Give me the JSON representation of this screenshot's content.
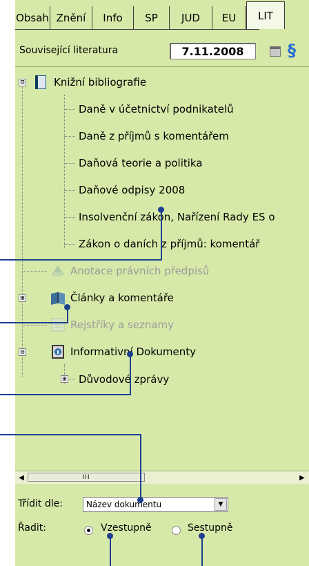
{
  "tabs": [
    "Obsah",
    "Znění",
    "Info",
    "SP",
    "JUD",
    "EU",
    "LIT"
  ],
  "active_tab": "LIT",
  "header": {
    "label": "Související literatura",
    "date": "7.11.2008",
    "paragraph_icon": "§",
    "calendar_icon": "calendar-icon"
  },
  "tree": [
    {
      "label": "Knižní bibliografie",
      "expander": "⊟",
      "icon": "book-icon"
    },
    {
      "label": "Daně v účetnictví podnikatelů"
    },
    {
      "label": "Daně z příjmů s komentářem"
    },
    {
      "label": "Daňová teorie a politika"
    },
    {
      "label": "Daňové odpisy 2008"
    },
    {
      "label": "Insolvenční zákon, Nařízení Rady ES o"
    },
    {
      "label": "Zákon o daních z příjmů: komentář"
    },
    {
      "label": "Anotace právních předpisů",
      "icon": "annotation-icon",
      "disabled": true
    },
    {
      "label": "Články a komentáře",
      "expander": "⊞",
      "icon": "articles-icon"
    },
    {
      "label": "Rejstříky a seznamy",
      "icon": "index-icon",
      "disabled": true
    },
    {
      "label": "Informativní Dokumenty",
      "expander": "⊟",
      "icon": "info-document-icon"
    },
    {
      "label": "Důvodové zprávy",
      "expander": "⊞"
    }
  ],
  "scrollbar": {
    "thumb_grip": "III",
    "left_arrow": "◀",
    "right_arrow": "▶"
  },
  "sort": {
    "label": "Třídit dle:",
    "value": "Název dokumentu",
    "arrow": "▼"
  },
  "order": {
    "label": "Řadit:",
    "ascending": "Vzestupně",
    "descending": "Sestupně",
    "selected": "ascending"
  }
}
